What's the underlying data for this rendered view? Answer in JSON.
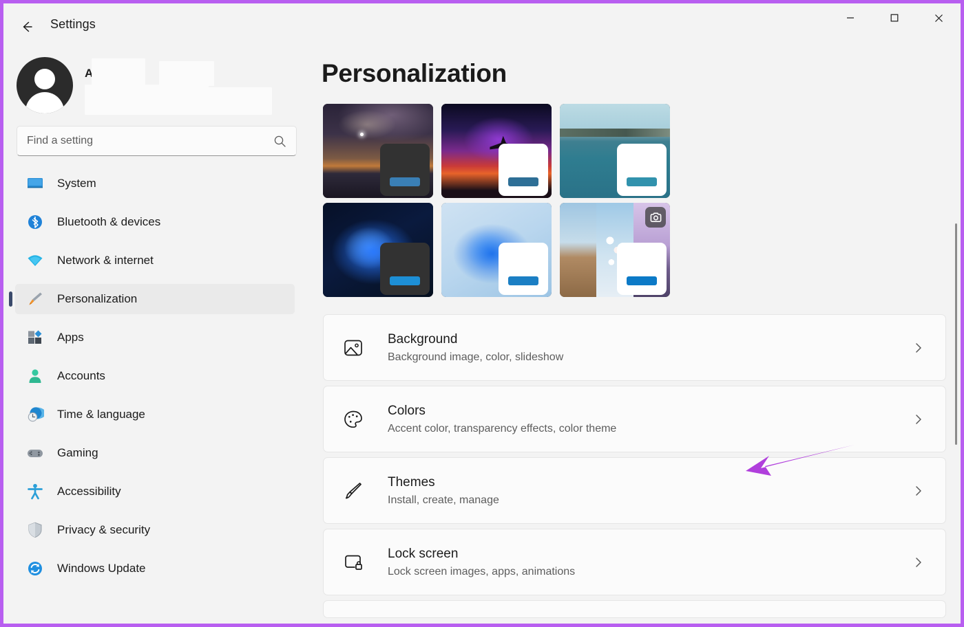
{
  "titlebar": {
    "back_icon": "back-arrow-icon",
    "app_title": "Settings",
    "minimize_label": "—",
    "maximize_label": "□",
    "close_label": "✕"
  },
  "account": {
    "avatar_icon": "default-user-avatar-icon",
    "display_name": "A        S",
    "note": "name partially redacted with white blocks"
  },
  "search": {
    "placeholder": "Find a setting",
    "value": "",
    "icon": "search-icon"
  },
  "sidebar": {
    "items": [
      {
        "label": "System",
        "icon": "monitor-icon",
        "active": false
      },
      {
        "label": "Bluetooth & devices",
        "icon": "bluetooth-icon",
        "active": false
      },
      {
        "label": "Network & internet",
        "icon": "wifi-icon",
        "active": false
      },
      {
        "label": "Personalization",
        "icon": "paintbrush-icon",
        "active": true
      },
      {
        "label": "Apps",
        "icon": "apps-grid-icon",
        "active": false
      },
      {
        "label": "Accounts",
        "icon": "person-icon",
        "active": false
      },
      {
        "label": "Time & language",
        "icon": "clock-globe-icon",
        "active": false
      },
      {
        "label": "Gaming",
        "icon": "gamepad-icon",
        "active": false
      },
      {
        "label": "Accessibility",
        "icon": "accessibility-person-icon",
        "active": false
      },
      {
        "label": "Privacy & security",
        "icon": "shield-icon",
        "active": false
      },
      {
        "label": "Windows Update",
        "icon": "refresh-circle-icon",
        "active": false
      }
    ]
  },
  "main": {
    "page_title": "Personalization",
    "themes": [
      {
        "name": "theme-night-sky",
        "art": "art-night",
        "taskbar": "dark",
        "accent": "#3a7fb5",
        "camera_badge": false
      },
      {
        "name": "theme-airplane",
        "art": "art-plane",
        "taskbar": "light",
        "accent": "#2e6f96",
        "camera_badge": false
      },
      {
        "name": "theme-lake",
        "art": "art-lake",
        "taskbar": "light",
        "accent": "#3192ad",
        "camera_badge": false
      },
      {
        "name": "theme-bloom-dark",
        "art": "art-bloom-dark",
        "taskbar": "dark",
        "accent": "#1d8fd6",
        "camera_badge": false
      },
      {
        "name": "theme-bloom-light",
        "art": "art-bloom-light",
        "taskbar": "light",
        "accent": "#1b7fc4",
        "camera_badge": false
      },
      {
        "name": "theme-slideshow",
        "art": "art-slideshow",
        "taskbar": "light",
        "accent": "#0c7ac7",
        "camera_badge": true
      }
    ],
    "rows": [
      {
        "title": "Background",
        "subtitle": "Background image, color, slideshow",
        "icon": "picture-icon",
        "chevron": "chevron-right-icon"
      },
      {
        "title": "Colors",
        "subtitle": "Accent color, transparency effects, color theme",
        "icon": "palette-icon",
        "chevron": "chevron-right-icon"
      },
      {
        "title": "Themes",
        "subtitle": "Install, create, manage",
        "icon": "brush-icon",
        "chevron": "chevron-right-icon"
      },
      {
        "title": "Lock screen",
        "subtitle": "Lock screen images, apps, animations",
        "icon": "lock-screen-icon",
        "chevron": "chevron-right-icon"
      }
    ]
  },
  "annotation": {
    "arrow_color": "#b03fdc",
    "points_at": "Colors"
  },
  "colors": {
    "window_border": "#b85ef0",
    "app_background": "#f3f3f3",
    "card_background": "#fbfbfb",
    "selection_indicator": "#3a4a6b",
    "text_primary": "#1b1b1b",
    "text_secondary": "#5d5d5d"
  }
}
